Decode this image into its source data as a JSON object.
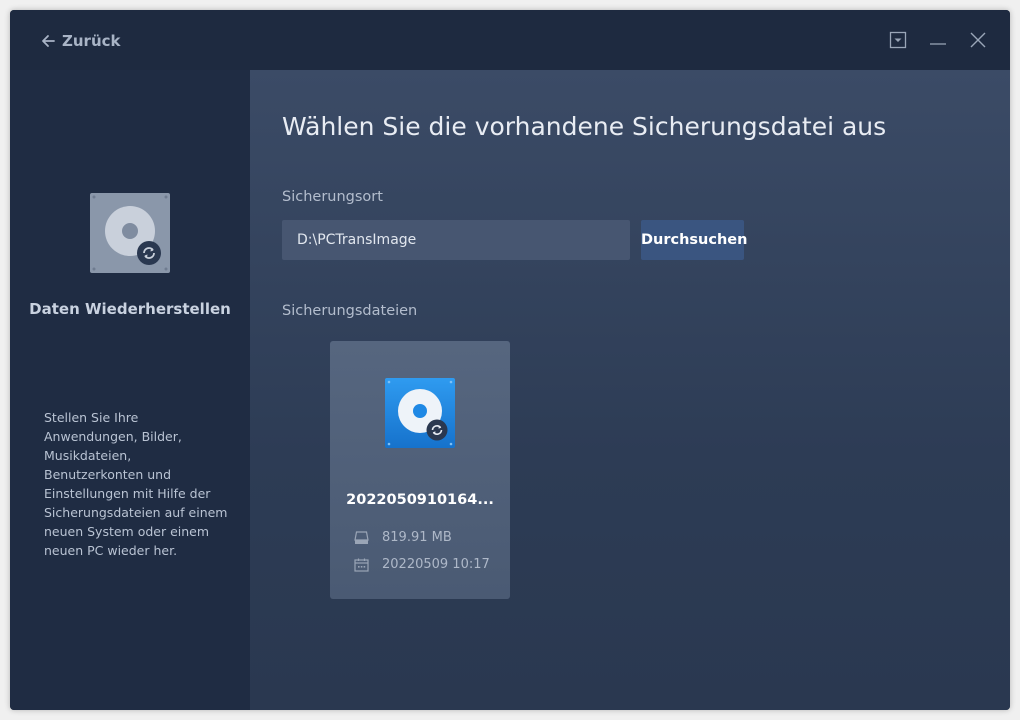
{
  "header": {
    "back_label": "Zurück"
  },
  "sidebar": {
    "title": "Daten Wiederherstellen",
    "description": "Stellen Sie Ihre Anwendungen, Bilder, Musikdateien, Benutzerkonten und Einstellungen mit Hilfe der Sicherungsdateien auf einem neuen System oder einem neuen PC wieder her."
  },
  "main": {
    "title": "Wählen Sie die vorhandene Sicherungsdatei aus",
    "location_label": "Sicherungsort",
    "location_value": "D:\\PCTransImage",
    "browse_label": "Durchsuchen",
    "files_label": "Sicherungsdateien",
    "files": [
      {
        "name": "2022050910164...",
        "size": "819.91 MB",
        "date": "20220509 10:17"
      }
    ]
  },
  "colors": {
    "accent": "#3a5580",
    "file_icon_blue": "#1e88e5"
  },
  "icons": {
    "back": "arrow-left-icon",
    "minimize_to_tray": "dropdown-box-icon",
    "minimize": "minimize-icon",
    "close": "close-icon",
    "restore": "disk-restore-icon",
    "size": "drive-icon",
    "date": "calendar-icon"
  }
}
